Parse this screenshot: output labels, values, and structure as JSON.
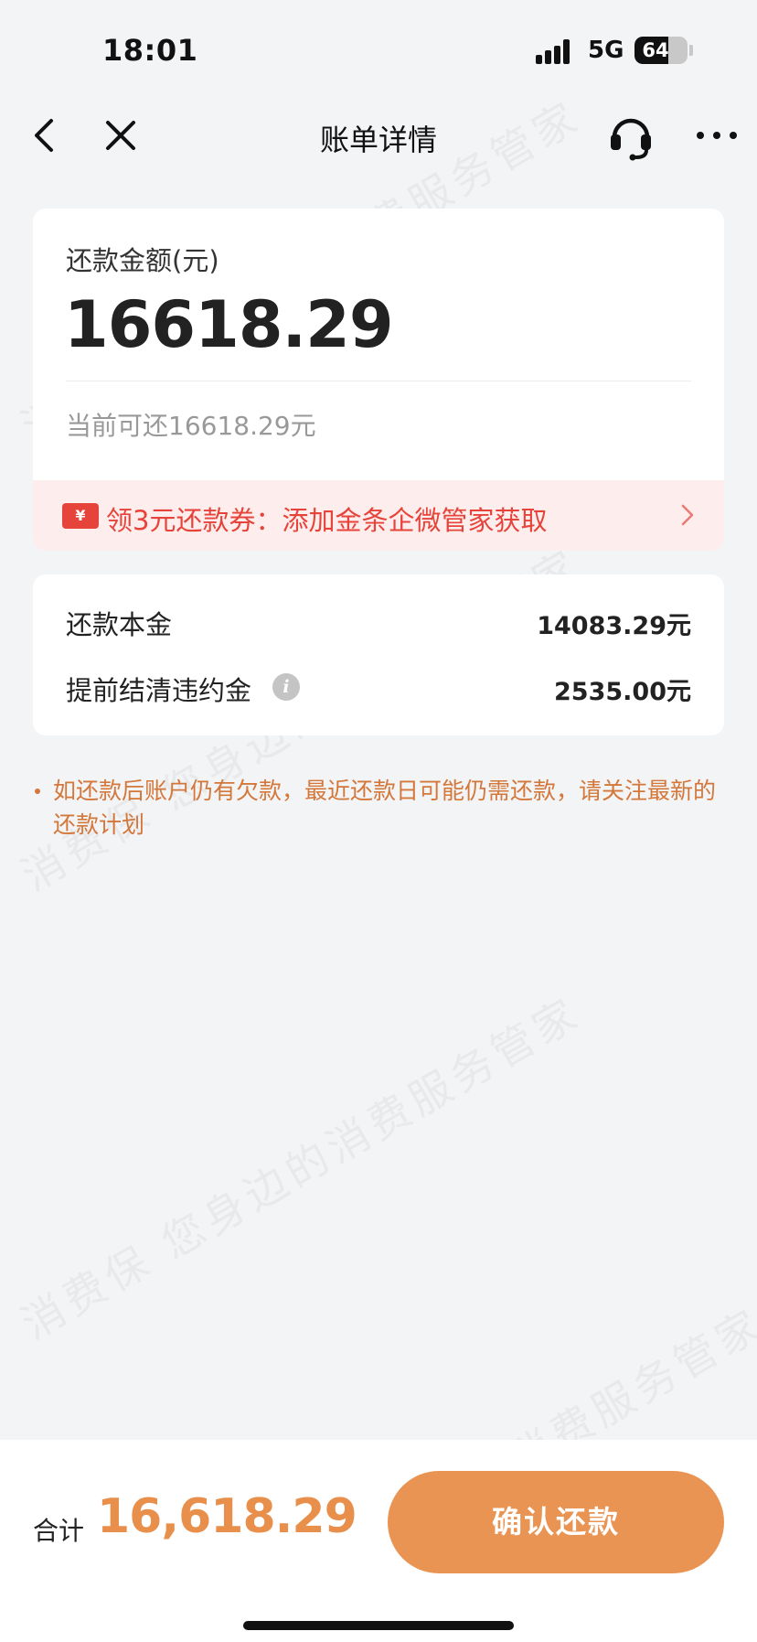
{
  "status_bar": {
    "time": "18:01",
    "network": "5G",
    "battery": "64",
    "battery_level": 0.64
  },
  "nav": {
    "title": "账单详情",
    "icons": [
      "back-icon",
      "close-icon",
      "headset-icon",
      "more-icon"
    ]
  },
  "amount_card": {
    "label": "还款金额(元)",
    "amount": "16618.29",
    "hint": "当前可还16618.29元",
    "coupon": {
      "icon_glyph": "¥",
      "text": "领3元还款券：添加金条企微管家获取"
    }
  },
  "details": [
    {
      "label": "还款本金",
      "value": "14083.29元",
      "has_info": false
    },
    {
      "label": "提前结清违约金",
      "value": "2535.00元",
      "has_info": true
    }
  ],
  "notice": "如还款后账户仍有欠款，最近还款日可能仍需还款，请关注最新的还款计划",
  "watermark": {
    "text": "消费保 您身边的消费服务管家"
  },
  "bottom": {
    "total_label": "合计",
    "total_value": "16,618.29",
    "confirm_label": "确认还款"
  },
  "colors": {
    "accent": "#ea9454",
    "total": "#e8904b",
    "coupon_red": "#e6443a",
    "coupon_bg": "#fdeeed",
    "notice": "#d4773a",
    "page_bg": "#f3f4f6"
  }
}
